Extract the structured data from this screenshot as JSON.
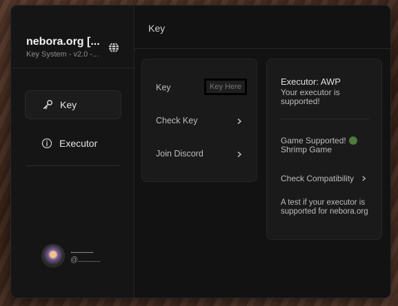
{
  "window": {
    "brand_title": "nebora.org [...",
    "brand_subtitle": "Key System - v2.0 -..."
  },
  "sidebar": {
    "items": [
      {
        "label": "Key",
        "icon": "key-icon",
        "active": true
      },
      {
        "label": "Executor",
        "icon": "info-icon",
        "active": false
      }
    ],
    "user": {
      "name": "................",
      "handle": "@................"
    }
  },
  "header": {
    "title": "Key"
  },
  "key_card": {
    "key_label": "Key",
    "key_placeholder": "Key Here",
    "check_key_label": "Check Key",
    "join_discord_label": "Join Discord"
  },
  "executor_card": {
    "title": "Executor: AWP",
    "description": "Your executor is supported!",
    "game_supported": "Game Supported!",
    "game_name": "Shrimp Game",
    "check_compat_label": "Check Compatibility",
    "compat_description": "A test if your executor is supported for nebora.org"
  },
  "colors": {
    "close": "#fe5f57",
    "minimize": "#febc2e",
    "status_ok": "#4e7a3a",
    "panel_bg": "#1a1a1a",
    "window_bg": "#121212"
  }
}
